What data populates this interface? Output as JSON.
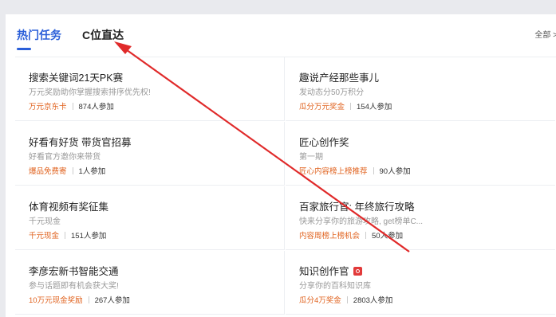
{
  "tabs": [
    {
      "label": "热门任务",
      "active": true
    },
    {
      "label": "C位直达",
      "active": false
    }
  ],
  "all_link": "全部 >",
  "cards": [
    {
      "title": "搜索关键词21天PK赛",
      "desc": "万元奖励助你掌握搜索排序优先权!",
      "reward": "万元京东卡",
      "participants": "874人参加"
    },
    {
      "title": "趣说产经那些事儿",
      "desc": "发动态分50万积分",
      "reward": "瓜分万元奖金",
      "participants": "154人参加"
    },
    {
      "title": "好看有好货 带货官招募",
      "desc": "好看官方邀你来带货",
      "reward": "爆品免费寄",
      "participants": "1人参加"
    },
    {
      "title": "匠心创作奖",
      "desc": "第一期",
      "reward": "匠心内容榜上榜推荐",
      "participants": "90人参加"
    },
    {
      "title": "体育视频有奖征集",
      "desc": "千元现金",
      "reward": "千元现金",
      "participants": "151人参加"
    },
    {
      "title": "百家旅行官: 年终旅行攻略",
      "desc": "快来分享你的旅游攻略, get榜单C...",
      "reward": "内容周榜上榜机会",
      "participants": "50人参加"
    },
    {
      "title": "李彦宏新书智能交通",
      "desc": "参与话题即有机会获大奖!",
      "reward": "10万元现金奖励",
      "participants": "267人参加"
    },
    {
      "title": "知识创作官",
      "desc": "分享你的百科知识库",
      "reward": "瓜分4万奖金",
      "participants": "2803人参加",
      "badge": "red-badge-icon"
    }
  ],
  "colors": {
    "accent": "#2b5fd9",
    "reward": "#e0621e",
    "arrow": "#e02a2a"
  }
}
